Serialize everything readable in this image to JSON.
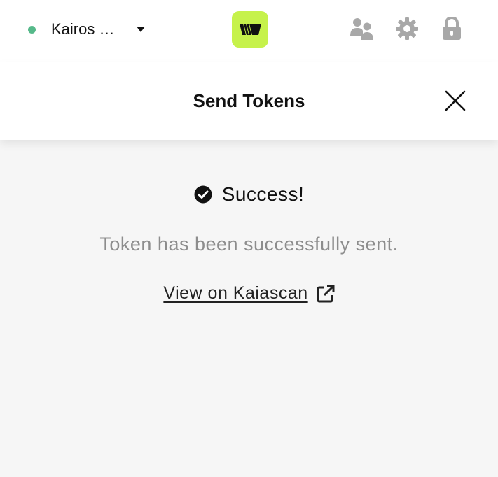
{
  "topbar": {
    "network": {
      "name": "Kairos …",
      "status_color": "#56b98a",
      "dot_icon": "status-dot-icon",
      "dropdown_icon": "caret-down-icon"
    },
    "logo": {
      "icon": "wallet-logo-icon",
      "color": "#c6f24b"
    },
    "icons": [
      "contacts-icon",
      "gear-icon",
      "lock-icon"
    ]
  },
  "header": {
    "title": "Send Tokens",
    "close_icon": "close-icon"
  },
  "result": {
    "status_icon": "check-circle-icon",
    "status": "Success!",
    "message": "Token has been successfully sent.",
    "link_label": "View on Kaiascan",
    "link_icon": "external-link-icon"
  }
}
